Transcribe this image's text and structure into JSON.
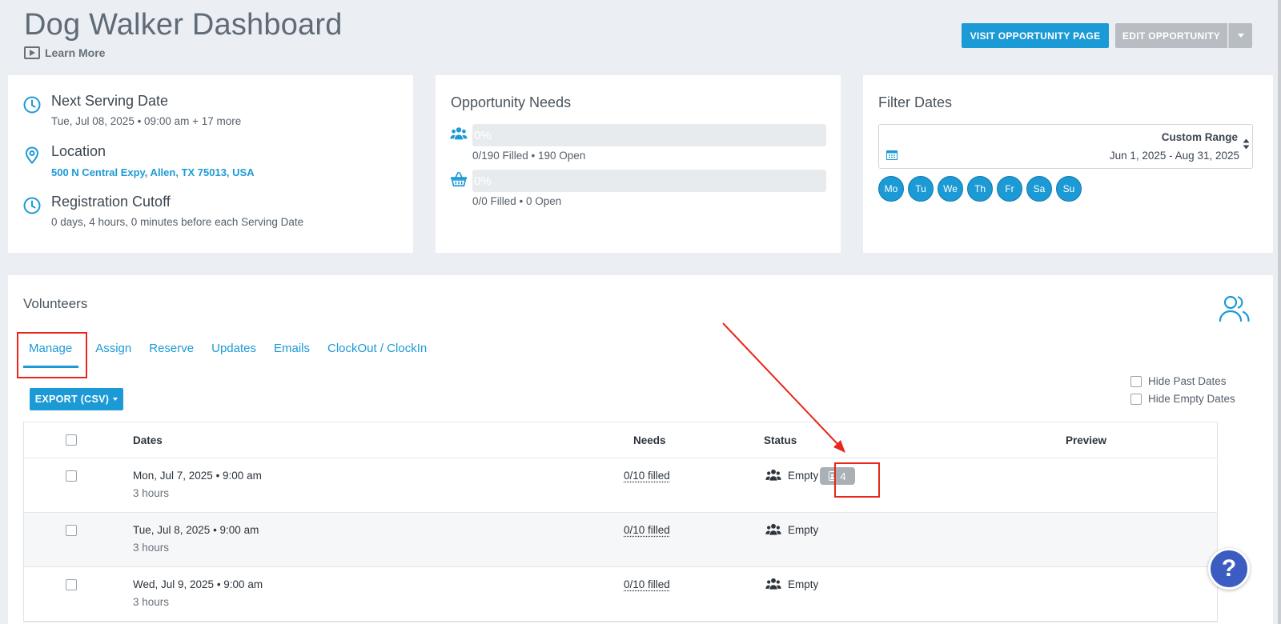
{
  "header": {
    "title": "Dog Walker Dashboard",
    "learn_more": "Learn More",
    "visit_button": "VISIT OPPORTUNITY PAGE",
    "edit_button": "EDIT OPPORTUNITY"
  },
  "info": {
    "next_serving_title": "Next Serving Date",
    "next_serving_value": "Tue, Jul 08, 2025 • 09:00 am + 17 more",
    "location_title": "Location",
    "location_value": "500 N Central Expy, Allen, TX 75013, USA",
    "cutoff_title": "Registration Cutoff",
    "cutoff_value": "0 days, 4 hours, 0 minutes before each Serving Date"
  },
  "needs": {
    "title": "Opportunity Needs",
    "rows": [
      {
        "percent_label": "0%",
        "progress": 0,
        "text": "0/190 Filled • 190 Open",
        "icon": "group-icon"
      },
      {
        "percent_label": "0%",
        "progress": 0,
        "text": "0/0 Filled • 0 Open",
        "icon": "basket-icon"
      }
    ]
  },
  "filter": {
    "title": "Filter Dates",
    "range_label": "Custom Range",
    "range_value": "Jun 1, 2025 - Aug 31, 2025",
    "days": [
      "Mo",
      "Tu",
      "We",
      "Th",
      "Fr",
      "Sa",
      "Su"
    ]
  },
  "volunteers": {
    "title": "Volunteers",
    "tabs": [
      "Manage",
      "Assign",
      "Reserve",
      "Updates",
      "Emails",
      "ClockOut / ClockIn"
    ],
    "active_tab": "Manage",
    "export_label": "EXPORT (CSV)",
    "hide_past": "Hide Past Dates",
    "hide_empty": "Hide Empty Dates",
    "columns": [
      "Dates",
      "Needs",
      "Status",
      "Preview"
    ],
    "rows": [
      {
        "date": "Mon, Jul 7, 2025 • 9:00 am",
        "duration": "3 hours",
        "needs": "0/10 filled",
        "status": "Empty",
        "badge": "4"
      },
      {
        "date": "Tue, Jul 8, 2025 • 9:00 am",
        "duration": "3 hours",
        "needs": "0/10 filled",
        "status": "Empty"
      },
      {
        "date": "Wed, Jul 9, 2025 • 9:00 am",
        "duration": "3 hours",
        "needs": "0/10 filled",
        "status": "Empty"
      }
    ]
  },
  "help_label": "?",
  "colors": {
    "accent": "#1c9ad6",
    "background": "#ebeef2",
    "annotation": "#e8271c",
    "help": "#3d5cc2"
  }
}
